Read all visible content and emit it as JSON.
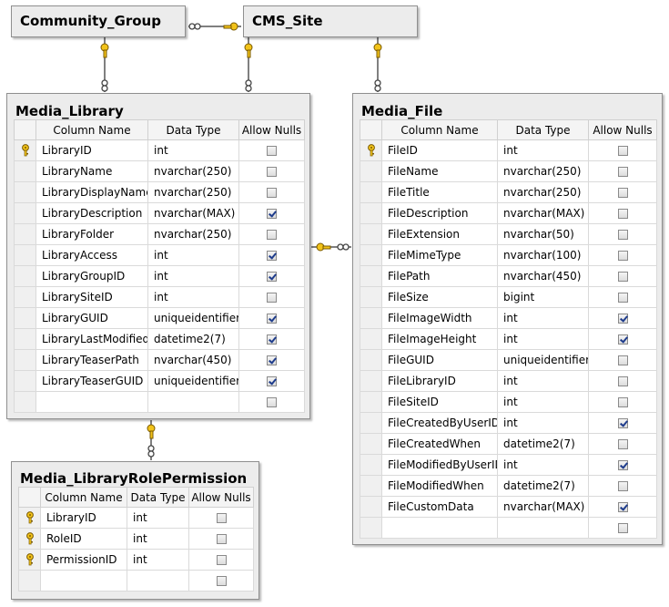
{
  "columns_header": {
    "column_name": "Column Name",
    "data_type": "Data Type",
    "allow_nulls": "Allow Nulls"
  },
  "tables": {
    "community_group": {
      "name": "Community_Group"
    },
    "cms_site": {
      "name": "CMS_Site"
    },
    "media_library": {
      "name": "Media_Library",
      "rows": [
        {
          "column": "LibraryID",
          "type": "int",
          "nullable": false,
          "key": true
        },
        {
          "column": "LibraryName",
          "type": "nvarchar(250)",
          "nullable": false,
          "key": false
        },
        {
          "column": "LibraryDisplayName",
          "type": "nvarchar(250)",
          "nullable": false,
          "key": false
        },
        {
          "column": "LibraryDescription",
          "type": "nvarchar(MAX)",
          "nullable": true,
          "key": false
        },
        {
          "column": "LibraryFolder",
          "type": "nvarchar(250)",
          "nullable": false,
          "key": false
        },
        {
          "column": "LibraryAccess",
          "type": "int",
          "nullable": true,
          "key": false
        },
        {
          "column": "LibraryGroupID",
          "type": "int",
          "nullable": true,
          "key": false
        },
        {
          "column": "LibrarySiteID",
          "type": "int",
          "nullable": false,
          "key": false
        },
        {
          "column": "LibraryGUID",
          "type": "uniqueidentifier",
          "nullable": true,
          "key": false
        },
        {
          "column": "LibraryLastModified",
          "type": "datetime2(7)",
          "nullable": true,
          "key": false
        },
        {
          "column": "LibraryTeaserPath",
          "type": "nvarchar(450)",
          "nullable": true,
          "key": false
        },
        {
          "column": "LibraryTeaserGUID",
          "type": "uniqueidentifier",
          "nullable": true,
          "key": false
        }
      ]
    },
    "media_file": {
      "name": "Media_File",
      "rows": [
        {
          "column": "FileID",
          "type": "int",
          "nullable": false,
          "key": true
        },
        {
          "column": "FileName",
          "type": "nvarchar(250)",
          "nullable": false,
          "key": false
        },
        {
          "column": "FileTitle",
          "type": "nvarchar(250)",
          "nullable": false,
          "key": false
        },
        {
          "column": "FileDescription",
          "type": "nvarchar(MAX)",
          "nullable": false,
          "key": false
        },
        {
          "column": "FileExtension",
          "type": "nvarchar(50)",
          "nullable": false,
          "key": false
        },
        {
          "column": "FileMimeType",
          "type": "nvarchar(100)",
          "nullable": false,
          "key": false
        },
        {
          "column": "FilePath",
          "type": "nvarchar(450)",
          "nullable": false,
          "key": false
        },
        {
          "column": "FileSize",
          "type": "bigint",
          "nullable": false,
          "key": false
        },
        {
          "column": "FileImageWidth",
          "type": "int",
          "nullable": true,
          "key": false
        },
        {
          "column": "FileImageHeight",
          "type": "int",
          "nullable": true,
          "key": false
        },
        {
          "column": "FileGUID",
          "type": "uniqueidentifier",
          "nullable": false,
          "key": false
        },
        {
          "column": "FileLibraryID",
          "type": "int",
          "nullable": false,
          "key": false
        },
        {
          "column": "FileSiteID",
          "type": "int",
          "nullable": false,
          "key": false
        },
        {
          "column": "FileCreatedByUserID",
          "type": "int",
          "nullable": true,
          "key": false
        },
        {
          "column": "FileCreatedWhen",
          "type": "datetime2(7)",
          "nullable": false,
          "key": false
        },
        {
          "column": "FileModifiedByUserID",
          "type": "int",
          "nullable": true,
          "key": false
        },
        {
          "column": "FileModifiedWhen",
          "type": "datetime2(7)",
          "nullable": false,
          "key": false
        },
        {
          "column": "FileCustomData",
          "type": "nvarchar(MAX)",
          "nullable": true,
          "key": false
        }
      ]
    },
    "media_library_role_permission": {
      "name": "Media_LibraryRolePermission",
      "rows": [
        {
          "column": "LibraryID",
          "type": "int",
          "nullable": false,
          "key": true
        },
        {
          "column": "RoleID",
          "type": "int",
          "nullable": false,
          "key": true
        },
        {
          "column": "PermissionID",
          "type": "int",
          "nullable": false,
          "key": true
        }
      ]
    }
  },
  "colors": {
    "key_gold": "#f2c31a",
    "key_outline": "#7a5a00",
    "connector": "#808080",
    "check": "#1e3c8c"
  }
}
